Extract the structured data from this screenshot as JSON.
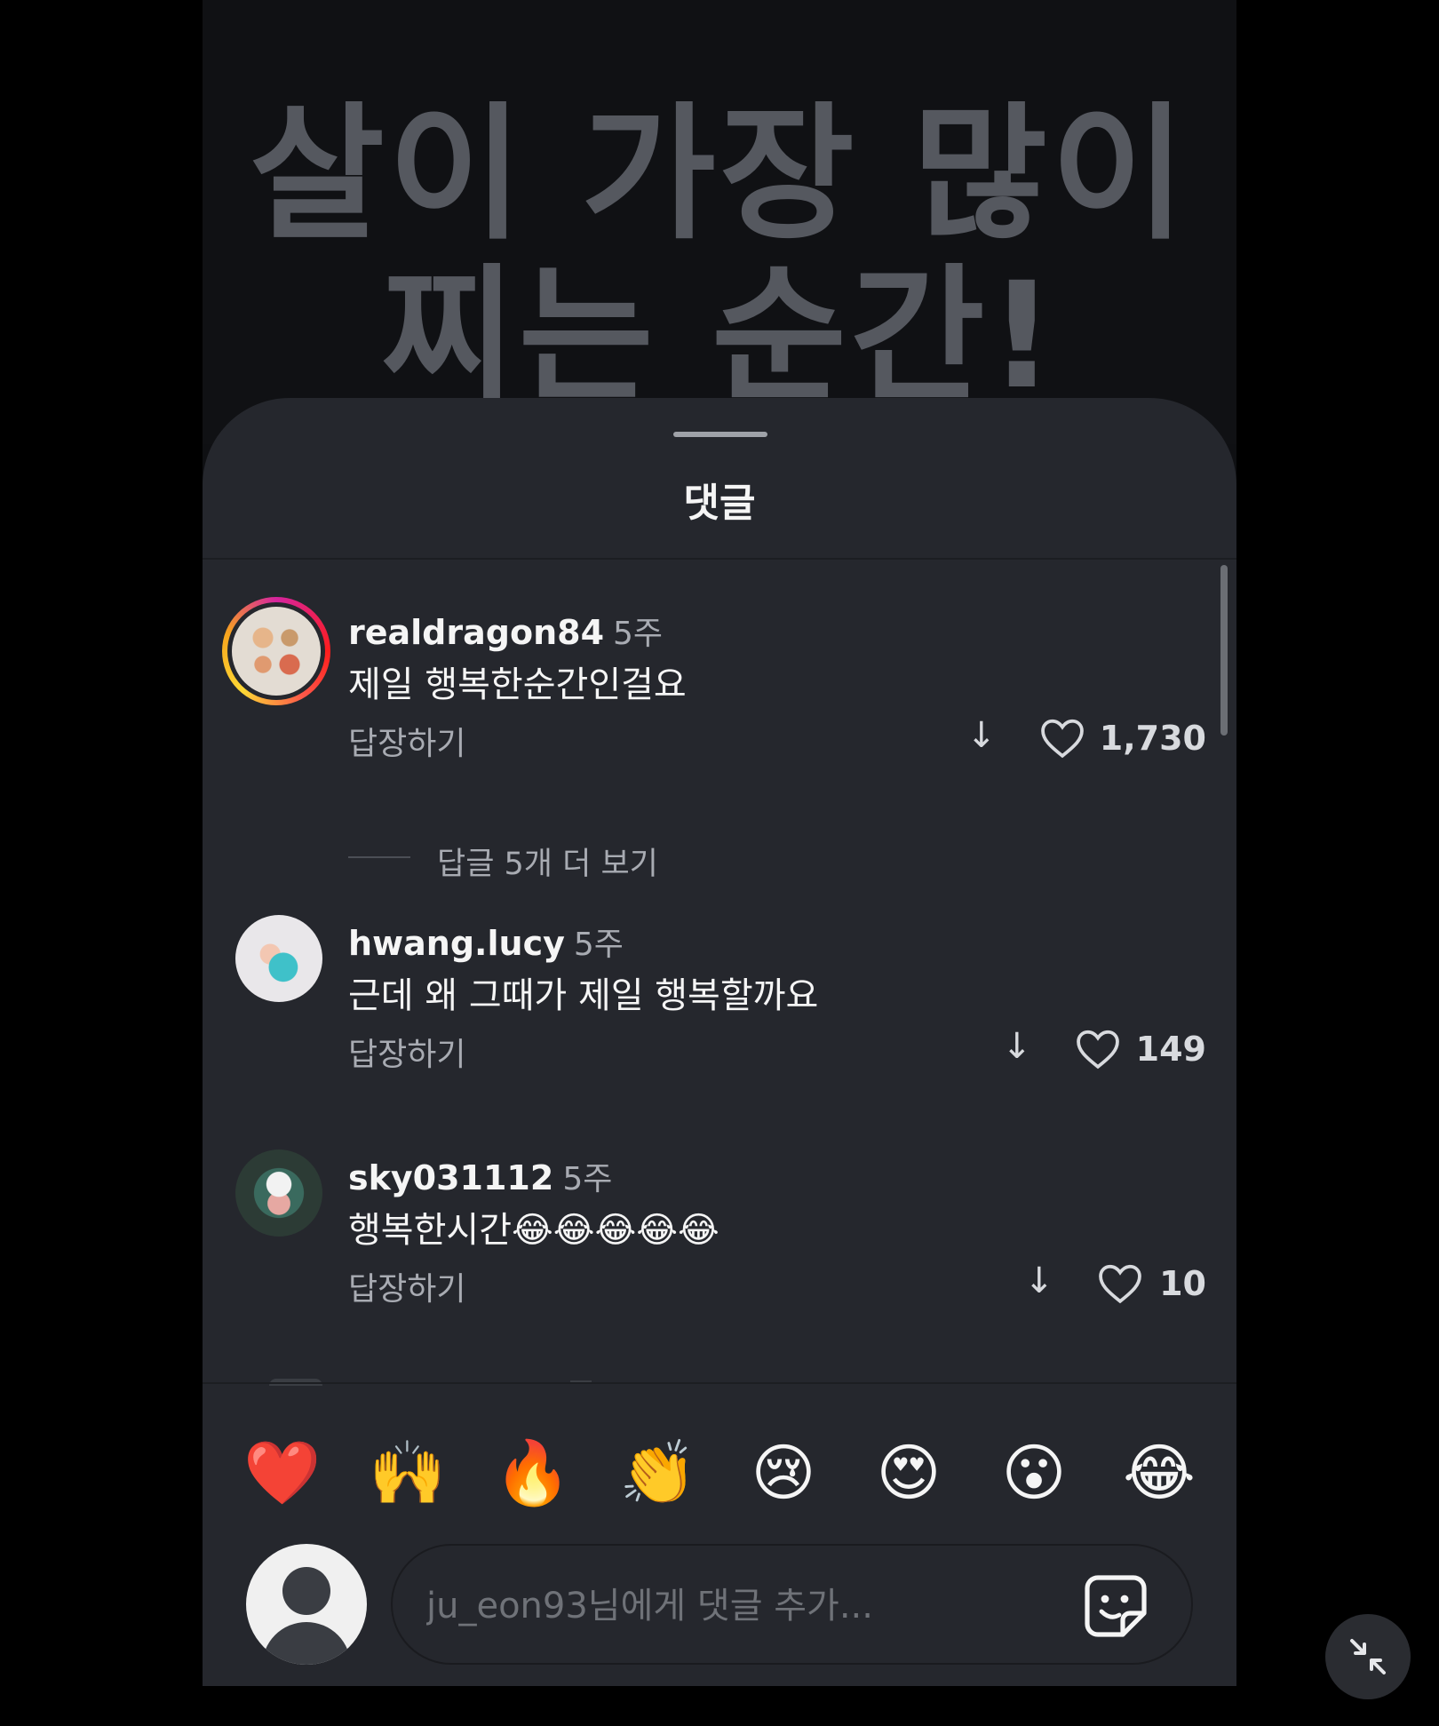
{
  "post": {
    "title_line1": "살이 가장 많이",
    "title_line2": "찌는 순간!"
  },
  "sheet": {
    "title": "댓글"
  },
  "comments": [
    {
      "username": "realdragon84",
      "time": "5주",
      "text": "제일 행복한순간인걸요",
      "reply_label": "답장하기",
      "likes": "1,730",
      "more_replies": "답글 5개 더 보기",
      "has_story_ring": true
    },
    {
      "username": "hwang.lucy",
      "time": "5주",
      "text": "근데 왜 그때가 제일 행복할까요",
      "reply_label": "답장하기",
      "likes": "149"
    },
    {
      "username": "sky031112",
      "time": "5주",
      "text": "행복한시간😂😂😂😂😂",
      "reply_label": "답장하기",
      "likes": "10"
    }
  ],
  "icons": {
    "like": "heart-icon",
    "translate": "arrow-down-icon",
    "sticker": "sticker-icon",
    "minimize": "minimize-icon"
  },
  "quick_reactions": [
    "❤️",
    "🙌",
    "🔥",
    "👏",
    "😢",
    "😍",
    "😮",
    "😂"
  ],
  "composer": {
    "placeholder": "ju_eon93님에게 댓글 추가..."
  },
  "colors": {
    "sheet_bg": "#25272d",
    "muted_text": "#a8abb2",
    "primary_text": "#f5f5f5"
  }
}
